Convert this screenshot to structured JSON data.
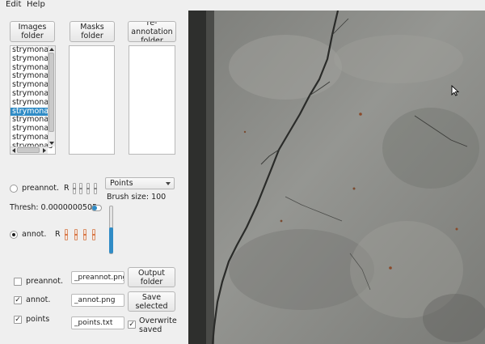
{
  "menu": {
    "edit": "Edit",
    "help": "Help"
  },
  "folder_buttons": {
    "images": "Images\nfolder",
    "masks": "Masks\nfolder",
    "reannotation": "re-annotation\nfolder"
  },
  "image_list": [
    "strymonas",
    "strymonas",
    "strymonas",
    "strymonas",
    "strymonas",
    "strymonas",
    "strymonas",
    "strymonas",
    "strymonas",
    "strymonas",
    "strymonas",
    "strymonas"
  ],
  "selected_index": 7,
  "modes": {
    "preannot_label": "preannot.",
    "annot_label": "annot.",
    "r_label": "R",
    "r_label2": "R",
    "preannot_checked": false,
    "annot_checked": true
  },
  "brush": {
    "mode_selected": "Points",
    "size_label": "Brush size: 100",
    "size_value": 100
  },
  "thresh_label": "Thresh: 0.0000000505",
  "output": {
    "preannot_check_label": "preannot.",
    "annot_check_label": "annot.",
    "points_check_label": "points",
    "preannot_checked": false,
    "annot_checked": true,
    "points_checked": true,
    "preannot_suffix": "_preannot.png",
    "annot_suffix": "_annot.png",
    "points_suffix": "_points.txt",
    "output_folder_btn": "Output\nfolder",
    "save_selected_btn": "Save\nselected",
    "overwrite_label": "Overwrite\nsaved",
    "overwrite_checked": true
  },
  "icons": {
    "cursor": "mouse-pointer-icon"
  },
  "colors": {
    "selection": "#308cc6",
    "accent_orange": "#d9906a",
    "crack_dark": "#2a2b29",
    "concrete": "#8c8d8a"
  }
}
